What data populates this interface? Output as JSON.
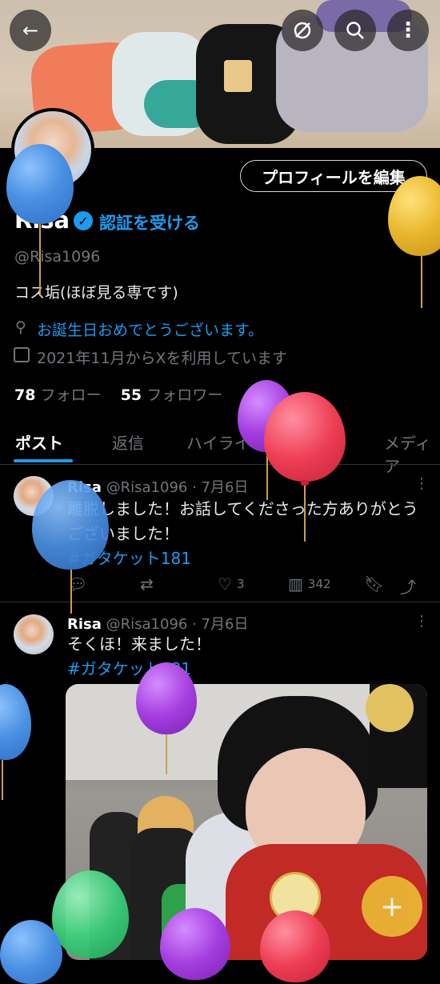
{
  "profile": {
    "name": "Risa",
    "verify_label": "認証を受ける",
    "handle": "@Risa1096",
    "bio": "コス垢(ほぼ見る専です)",
    "location": "お誕生日おめでとうございます。",
    "joined": "2021年11月からXを利用しています",
    "following_count": "78",
    "following_label": "フォロー",
    "followers_count": "55",
    "followers_label": "フォロワー",
    "edit_profile_label": "プロフィールを編集"
  },
  "header": {
    "back_icon": "back-arrow-icon",
    "grok_icon": "grok-icon",
    "search_icon": "search-icon",
    "more_icon": "more-vertical-icon"
  },
  "tabs": [
    {
      "label": "ポスト",
      "active": true
    },
    {
      "label": "返信"
    },
    {
      "label": "ハイライト"
    },
    {
      "label": "メディア"
    }
  ],
  "tweets": [
    {
      "name": "Risa",
      "handle": "@Risa1096",
      "date": "7月6日",
      "text": "離脱しました！お話してくださった方ありがとうございました！",
      "hashtag": "#ガタケット181",
      "likes": "3",
      "views": "342"
    },
    {
      "name": "Risa",
      "handle": "@Risa1096",
      "date": "7月6日",
      "text": "そくほ！来ました！",
      "hashtag": "#ガタケット181"
    }
  ],
  "colors": {
    "accent": "#1d9bf0",
    "background": "#000000",
    "muted": "#71767b"
  }
}
